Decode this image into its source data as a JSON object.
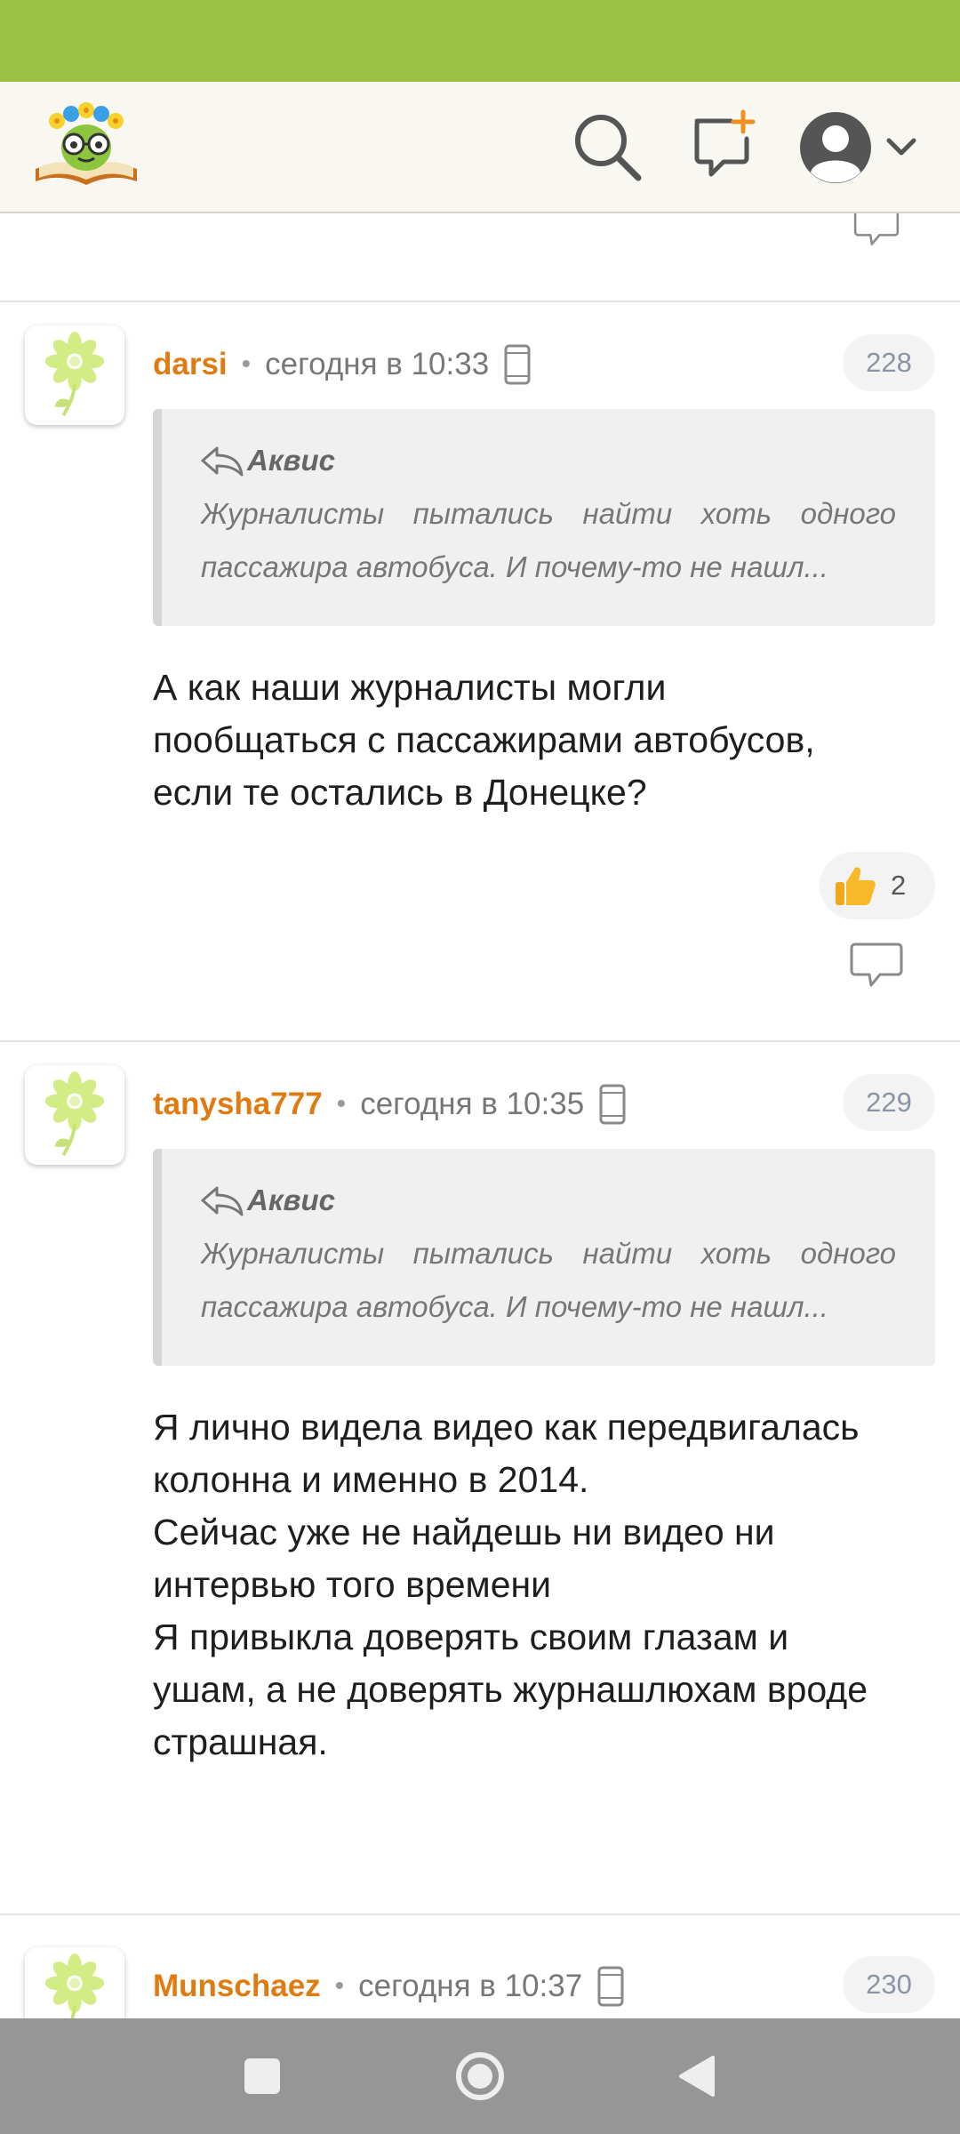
{
  "app": {
    "brand_color": "#9cc244",
    "header_icons": [
      "search-icon",
      "new-post-icon",
      "user-avatar-icon",
      "chevron-down-icon"
    ]
  },
  "comments": [
    {
      "author": "darsi",
      "time": "сегодня в 10:33",
      "number": "228",
      "quote_author": "Аквис",
      "quote_line1": "Журналисты пытались найти хоть одного",
      "quote_line2": "пассажира автобуса. И почему-то не нашл...",
      "body": [
        "А как наши журналисты могли",
        "пообщаться с пассажирами автобусов,",
        "если те остались в Донецке?"
      ],
      "reaction_count": "2"
    },
    {
      "author": "tanysha777",
      "time": "сегодня в 10:35",
      "number": "229",
      "quote_author": "Аквис",
      "quote_line1": "Журналисты пытались найти хоть одного",
      "quote_line2": "пассажира автобуса. И почему-то не нашл...",
      "body": [
        "Я лично видела видео как передвигалась",
        "колонна и именно в 2014.",
        "Сейчас уже не найдешь ни видео ни",
        "интервью того времени",
        "Я привыкла доверять своим глазам и",
        "ушам, а не доверять журнашлюхам вроде",
        "страшная."
      ]
    },
    {
      "author": "Munschaez",
      "time": "сегодня в 10:37",
      "number": "230"
    }
  ]
}
